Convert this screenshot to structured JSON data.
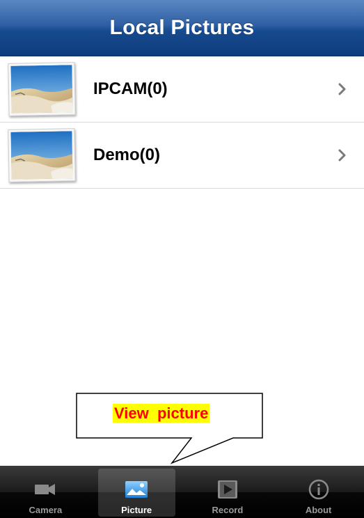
{
  "header": {
    "title": "Local Pictures"
  },
  "albums": [
    {
      "label": "IPCAM(0)",
      "thumbnail_icon": "desert-landscape-thumbnail",
      "chevron_icon": "chevron-right-icon"
    },
    {
      "label": "Demo(0)",
      "thumbnail_icon": "desert-landscape-thumbnail",
      "chevron_icon": "chevron-right-icon"
    }
  ],
  "callout": {
    "text": "View  picture",
    "text_color": "#ff0000",
    "highlight_color": "#ffff00"
  },
  "tabbar": {
    "selected": "Picture",
    "tabs": [
      {
        "label": "Camera",
        "icon": "video-camera-icon"
      },
      {
        "label": "Picture",
        "icon": "picture-icon"
      },
      {
        "label": "Record",
        "icon": "record-play-icon"
      },
      {
        "label": "About",
        "icon": "info-icon"
      }
    ]
  },
  "colors": {
    "navbar": "#174a8f",
    "tabbar": "#000000",
    "accent": "#3d9be9"
  }
}
